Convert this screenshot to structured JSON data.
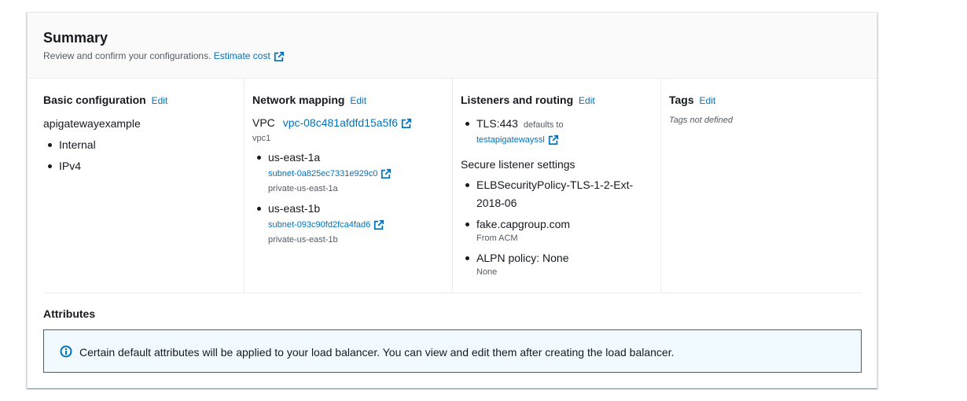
{
  "summary": {
    "title": "Summary",
    "description": "Review and confirm your configurations.",
    "estimate_link": "Estimate cost"
  },
  "basic": {
    "title": "Basic configuration",
    "edit": "Edit",
    "name": "apigatewayexample",
    "items": [
      "Internal",
      "IPv4"
    ]
  },
  "network": {
    "title": "Network mapping",
    "edit": "Edit",
    "vpc_label": "VPC",
    "vpc_id": "vpc-08c481afdfd15a5f6",
    "vpc_name": "vpc1",
    "zones": [
      {
        "name": "us-east-1a",
        "subnet": "subnet-0a825ec7331e929c0",
        "subnet_name": "private-us-east-1a"
      },
      {
        "name": "us-east-1b",
        "subnet": "subnet-093c90fd2fca4fad6",
        "subnet_name": "private-us-east-1b"
      }
    ]
  },
  "listeners": {
    "title": "Listeners and routing",
    "edit": "Edit",
    "listener": "TLS:443",
    "defaults_to": "defaults to",
    "target": "testapigatewayssl",
    "secure_title": "Secure listener settings",
    "policy_line1": "ELBSecurityPolicy-TLS-1-2-Ext-",
    "policy_line2": "2018-06",
    "cert": "fake.capgroup.com",
    "cert_source": "From ACM",
    "alpn": "ALPN policy: None",
    "alpn_sub": "None"
  },
  "tags": {
    "title": "Tags",
    "edit": "Edit",
    "empty": "Tags not defined"
  },
  "attributes": {
    "title": "Attributes",
    "info": "Certain default attributes will be applied to your load balancer. You can view and edit them after creating the load balancer."
  },
  "colors": {
    "link": "#0073bb",
    "info_bg": "#f1faff",
    "text": "#16191f",
    "muted": "#545b64"
  }
}
